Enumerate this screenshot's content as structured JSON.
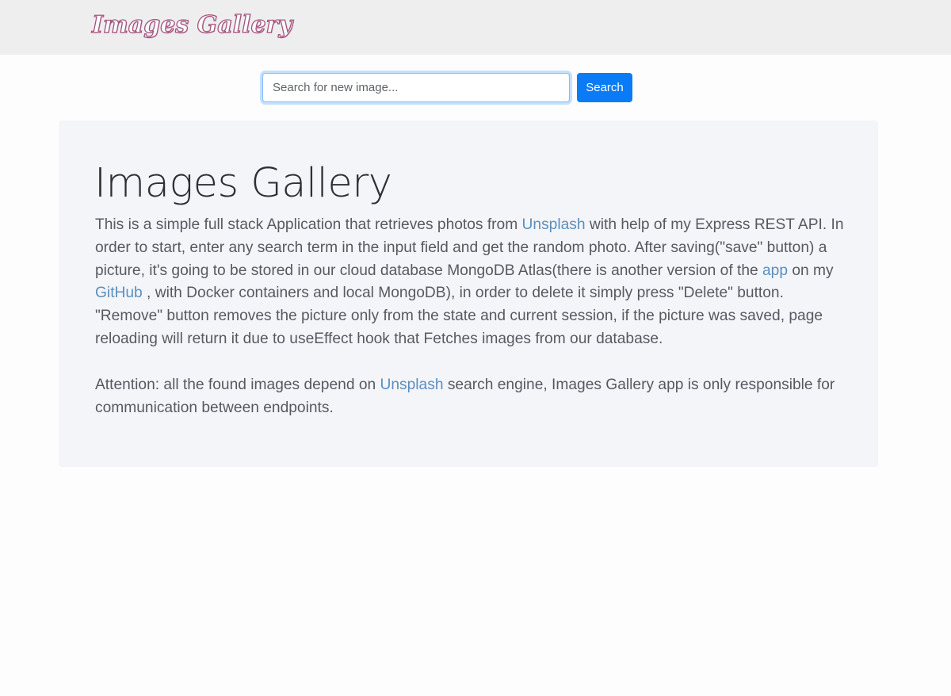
{
  "navbar": {
    "brand": "Images Gallery"
  },
  "search": {
    "placeholder": "Search for new image...",
    "value": "",
    "button_label": "Search"
  },
  "jumbotron": {
    "title": "Images Gallery",
    "paragraph1": {
      "t1": "This is a simple full stack Application that retrieves photos from ",
      "link1": "Unsplash",
      "t2": " with help of my Express REST API. In order to start, enter any search term in the input field and get the random photo. After saving(\"save\" button) a picture, it's going to be stored in our cloud database MongoDB Atlas(there is another version of the ",
      "link2": "app",
      "t3": " on my ",
      "link3": "GitHub",
      "t4": " , with Docker containers and local MongoDB), in order to delete it simply press \"Delete\" button. \"Remove\" button removes the picture only from the state and current session, if the picture was saved, page reloading will return it due to useEffect hook that Fetches images from our database."
    },
    "paragraph2": {
      "t1": "Attention: all the found images depend on ",
      "link1": "Unsplash",
      "t2": " search engine, Images Gallery app is only responsible for communication between endpoints."
    }
  },
  "colors": {
    "navbar_bg": "#efeeef",
    "brand_outline": "#a3527f",
    "primary_button": "#0a7bf6",
    "jumbotron_bg": "#f4f5f9",
    "link": "#5b8fbd"
  }
}
